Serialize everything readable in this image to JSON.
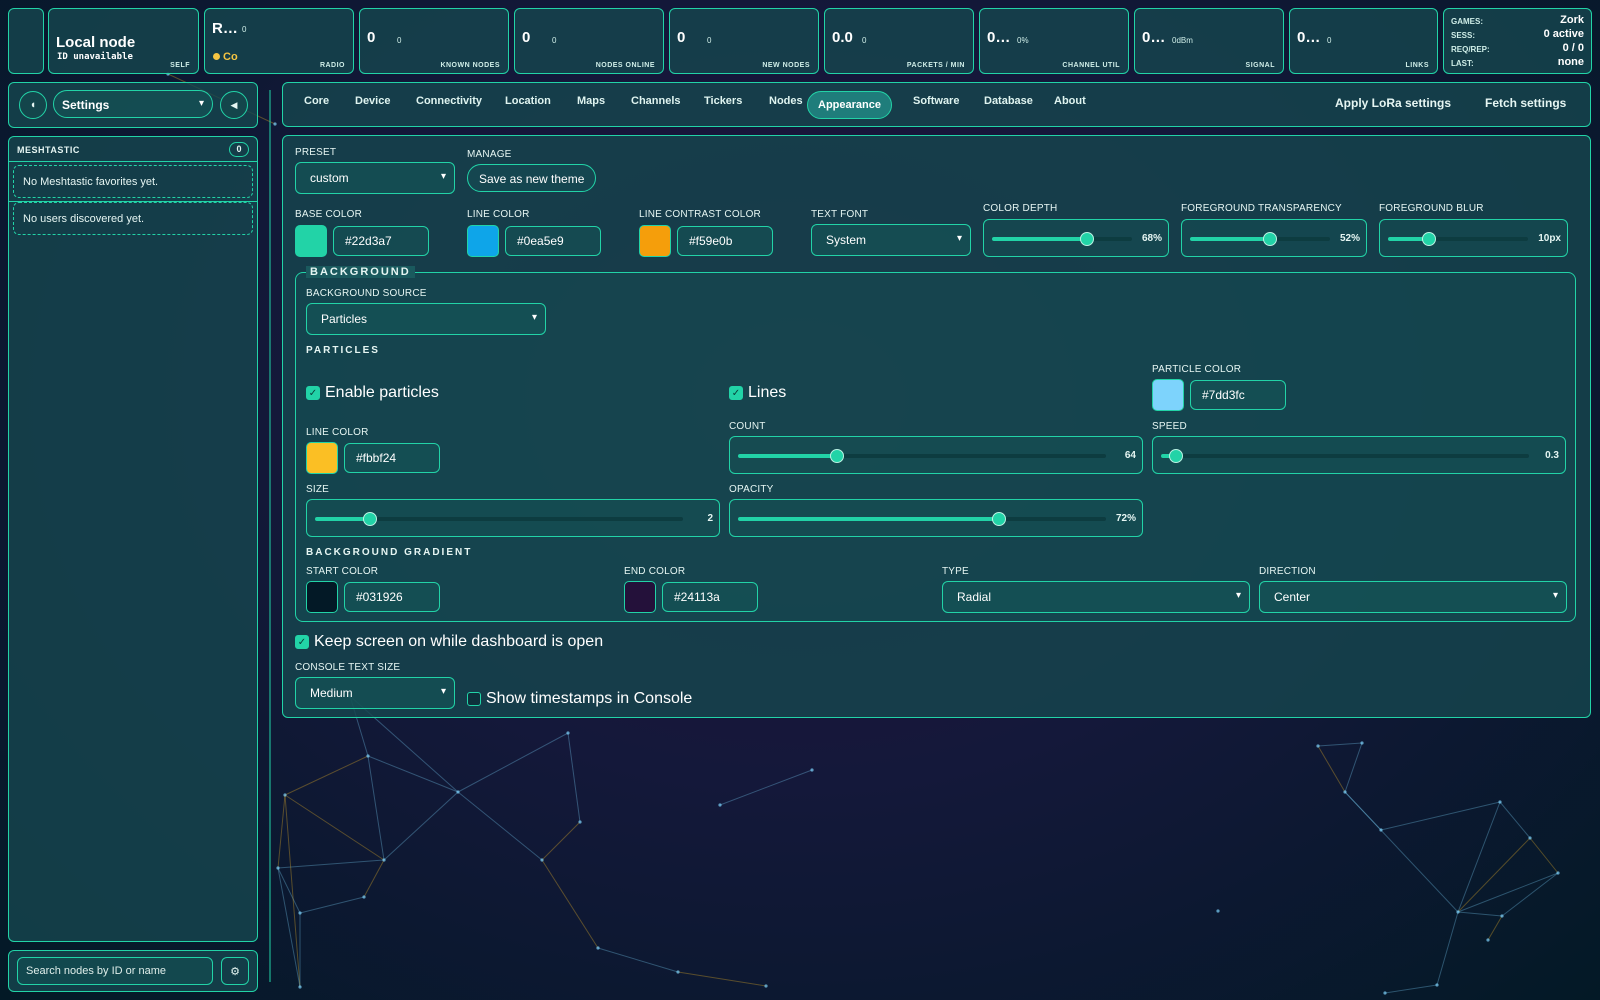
{
  "stats": {
    "self": {
      "title": "Local node",
      "sub": "ID unavailable",
      "label": "SELF"
    },
    "radio": {
      "value": "R…",
      "small": "0",
      "status": "Co",
      "label": "RADIO"
    },
    "known_nodes": {
      "value": "0",
      "small": "0",
      "label": "KNOWN NODES"
    },
    "nodes_online": {
      "value": "0",
      "small": "0",
      "label": "NODES ONLINE"
    },
    "new_nodes": {
      "value": "0",
      "small": "0",
      "label": "NEW NODES"
    },
    "packets": {
      "value": "0.0",
      "small": "0",
      "label": "PACKETS / MIN"
    },
    "channel_util": {
      "value": "0…",
      "small": "0%",
      "label": "CHANNEL UTIL"
    },
    "signal": {
      "value": "0…",
      "small": "0dBm",
      "label": "SIGNAL"
    },
    "links": {
      "value": "0…",
      "small": "0",
      "label": "LINKS"
    },
    "games": {
      "games_label": "GAMES:",
      "games_value": "Zork",
      "sess_label": "SESS:",
      "sess_value": "0 active",
      "req_label": "REQ/REP:",
      "req_value": "0 / 0",
      "last_label": "LAST:",
      "last_value": "none"
    }
  },
  "sidebar": {
    "view_select": "Settings",
    "section_title": "MESHTASTIC",
    "count": "0",
    "favorites_empty": "No Meshtastic favorites yet.",
    "users_empty": "No users discovered yet.",
    "search_placeholder": "Search nodes by ID or name"
  },
  "tabs": [
    "Core",
    "Device",
    "Connectivity",
    "Location",
    "Maps",
    "Channels",
    "Tickers",
    "Nodes",
    "Appearance",
    "Software",
    "Database",
    "About"
  ],
  "active_tab": "Appearance",
  "actions": {
    "apply": "Apply LoRa settings",
    "fetch": "Fetch settings"
  },
  "appearance": {
    "preset_label": "PRESET",
    "preset_value": "custom",
    "manage_label": "MANAGE",
    "save_theme": "Save as new theme",
    "base_color_label": "BASE COLOR",
    "base_color": "#22d3a7",
    "line_color_label": "LINE COLOR",
    "line_color": "#0ea5e9",
    "line_contrast_label": "LINE CONTRAST COLOR",
    "line_contrast_color": "#f59e0b",
    "text_font_label": "TEXT FONT",
    "text_font": "System",
    "color_depth_label": "COLOR DEPTH",
    "color_depth": "68%",
    "color_depth_frac": 0.68,
    "fg_transparency_label": "FOREGROUND TRANSPARENCY",
    "fg_transparency": "52%",
    "fg_transparency_frac": 0.57,
    "fg_blur_label": "FOREGROUND BLUR",
    "fg_blur": "10px",
    "fg_blur_frac": 0.29
  },
  "background": {
    "legend": "BACKGROUND",
    "source_label": "BACKGROUND SOURCE",
    "source": "Particles",
    "particles_title": "PARTICLES",
    "enable_particles": "Enable particles",
    "lines": "Lines",
    "particle_color_label": "PARTICLE COLOR",
    "particle_color": "#7dd3fc",
    "line_color_label": "LINE COLOR",
    "line_color": "#fbbf24",
    "count_label": "COUNT",
    "count": "64",
    "count_frac": 0.27,
    "speed_label": "SPEED",
    "speed": "0.3",
    "speed_frac": 0.04,
    "size_label": "SIZE",
    "size": "2",
    "size_frac": 0.15,
    "opacity_label": "OPACITY",
    "opacity": "72%",
    "opacity_frac": 0.71,
    "gradient_title": "BACKGROUND GRADIENT",
    "start_color_label": "START COLOR",
    "start_color": "#031926",
    "end_color_label": "END COLOR",
    "end_color": "#24113a",
    "type_label": "TYPE",
    "type": "Radial",
    "direction_label": "DIRECTION",
    "direction": "Center"
  },
  "misc": {
    "keep_screen_on": "Keep screen on while dashboard is open",
    "console_text_size_label": "CONSOLE TEXT SIZE",
    "console_text_size": "Medium",
    "show_timestamps": "Show timestamps in Console"
  }
}
